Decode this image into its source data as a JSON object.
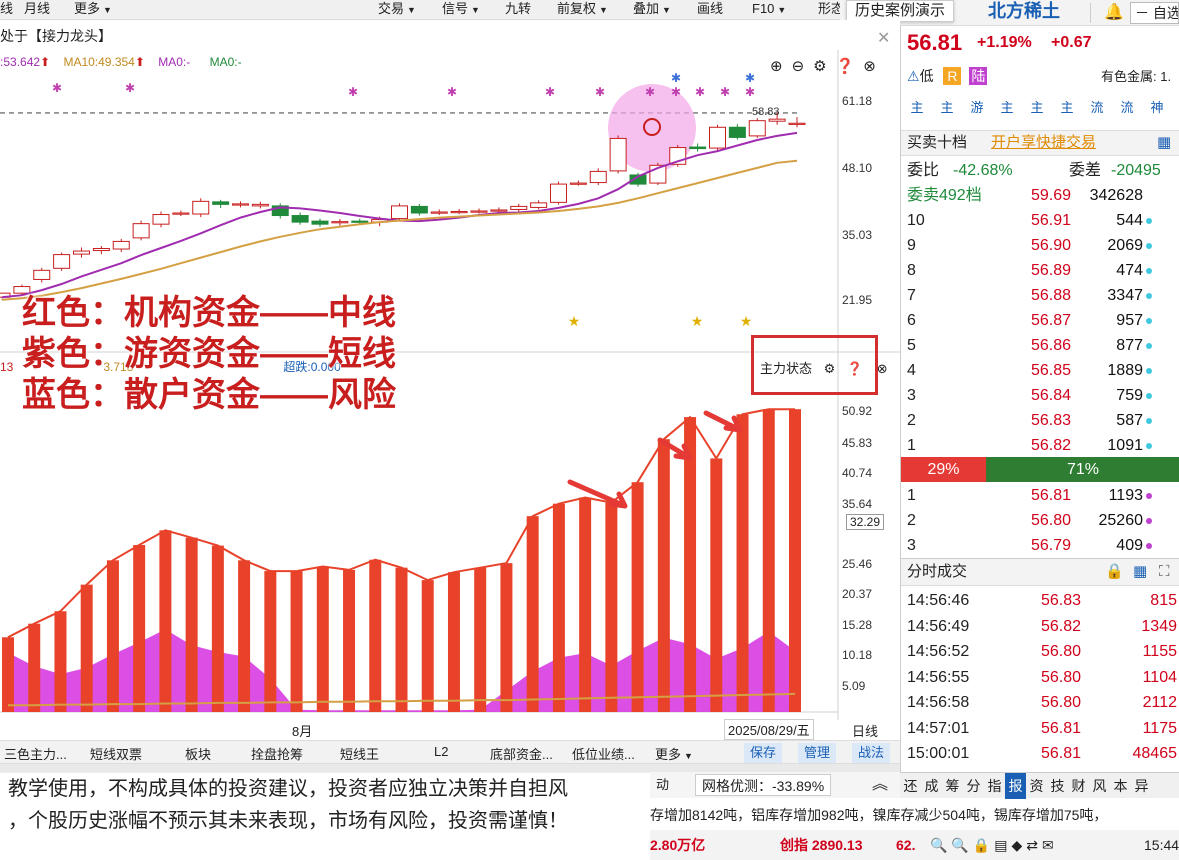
{
  "toolbar": {
    "left_items": [
      "线",
      "月线",
      "更多"
    ],
    "right_items": [
      "交易",
      "信号",
      "九转",
      "前复权",
      "叠加",
      "画线",
      "F10",
      "形态"
    ]
  },
  "history_demo": "历史案例演示",
  "stock_name": "北方稀土",
  "window_title": "处于【接力龙头】",
  "ma_legend": {
    "ma5": "53.642",
    "ma10": "MA10:49.354",
    "ma0a": "MA0:-",
    "ma0b": "MA0:-"
  },
  "upper_axis": [
    "61.18",
    "48.10",
    "35.03",
    "21.95"
  ],
  "price_marker": "58.83",
  "lower_axis": [
    "50.92",
    "45.83",
    "40.74",
    "35.64",
    "32.29",
    "25.46",
    "20.37",
    "15.28",
    "10.18",
    "5.09"
  ],
  "lower_legend": {
    "a": "13",
    "b": "3.718",
    "c": "超跌:0.000"
  },
  "lower_panel_title": "主力状态",
  "annotation": [
    "红色：机构资金——中线",
    "紫色：游资资金——短线",
    "蓝色：散户资金——风险"
  ],
  "x_axis": {
    "month": "8月",
    "date": "2025/08/29/五",
    "period": "日线"
  },
  "bottom_tabs": [
    "三色主力...",
    "短线双票",
    "板块",
    "拴盘抢筹",
    "短线王",
    "L2",
    "底部资金...",
    "低位业绩...",
    "更多"
  ],
  "bottom_buttons": [
    "保存",
    "管理",
    "战法"
  ],
  "disclaimer": [
    "教学使用，不构成具体的投资建议，投资者应独立决策并自担风",
    "，个股历史涨幅不预示其未来表现，市场有风险，投资需谨慎！"
  ],
  "grid_forecast": "网格优测：-33.89%",
  "ticker_text": "存增加8142吨，铝库存增加982吨，镍库存减少504吨，锡库存增加75吨，",
  "status_bar": {
    "a": "2.80万亿",
    "b": "创指 2890.13",
    "c": "62.",
    "time": "15:44"
  },
  "quote": {
    "price": "56.81",
    "pct": "+1.19%",
    "chg": "+0.67",
    "low_tag": "低",
    "r_tag": "R",
    "lu_tag": "陆",
    "industry": "有色金属: 1."
  },
  "flow_tags": [
    "主",
    "主",
    "游",
    "主",
    "主",
    "主",
    "流",
    "流",
    "神"
  ],
  "trade10": {
    "label": "买卖十档",
    "link": "开户享快捷交易"
  },
  "weibi": {
    "label": "委比",
    "value": "-42.68%",
    "label2": "委差",
    "value2": "-20495"
  },
  "weimai": {
    "label": "委卖492档",
    "price": "59.69",
    "vol": "342628"
  },
  "asks": [
    {
      "n": "10",
      "p": "56.91",
      "v": "544"
    },
    {
      "n": "9",
      "p": "56.90",
      "v": "2069"
    },
    {
      "n": "8",
      "p": "56.89",
      "v": "474"
    },
    {
      "n": "7",
      "p": "56.88",
      "v": "3347"
    },
    {
      "n": "6",
      "p": "56.87",
      "v": "957"
    },
    {
      "n": "5",
      "p": "56.86",
      "v": "877"
    },
    {
      "n": "4",
      "p": "56.85",
      "v": "1889"
    },
    {
      "n": "3",
      "p": "56.84",
      "v": "759"
    },
    {
      "n": "2",
      "p": "56.83",
      "v": "587"
    },
    {
      "n": "1",
      "p": "56.82",
      "v": "1091"
    }
  ],
  "ratio": {
    "sell": "29%",
    "buy": "71%"
  },
  "bids": [
    {
      "n": "1",
      "p": "56.81",
      "v": "1193"
    },
    {
      "n": "2",
      "p": "56.80",
      "v": "25260"
    },
    {
      "n": "3",
      "p": "56.79",
      "v": "409"
    }
  ],
  "ticks_title": "分时成交",
  "ticks": [
    {
      "t": "14:56:46",
      "p": "56.83",
      "v": "815"
    },
    {
      "t": "14:56:49",
      "p": "56.82",
      "v": "1349"
    },
    {
      "t": "14:56:52",
      "p": "56.80",
      "v": "1155"
    },
    {
      "t": "14:56:55",
      "p": "56.80",
      "v": "1104"
    },
    {
      "t": "14:56:58",
      "p": "56.80",
      "v": "2112"
    },
    {
      "t": "14:57:01",
      "p": "56.81",
      "v": "1175"
    },
    {
      "t": "15:00:01",
      "p": "56.81",
      "v": "48465"
    }
  ],
  "right_tabs": [
    "还",
    "成",
    "筹",
    "分",
    "指",
    "报",
    "资",
    "技",
    "财",
    "风",
    "本",
    "异"
  ],
  "colors": {
    "red": "#e8432a",
    "purple": "#d630e0",
    "ma_brown": "#d4a043",
    "ma_purple": "#a02cb0",
    "down_green": "#1f8a3a"
  },
  "chart_data": [
    {
      "type": "candlestick",
      "title": "",
      "yaxis_ticks": [
        61.18,
        48.1,
        35.03,
        21.95
      ],
      "ylim": [
        15,
        64
      ],
      "marker_price": 58.83,
      "candles": [
        [
          22.5,
          23.3,
          22.2,
          22.0
        ],
        [
          23.3,
          24.6,
          22.9,
          25.0
        ],
        [
          26.0,
          27.8,
          25.4,
          28.3
        ],
        [
          28.2,
          30.9,
          27.7,
          31.3
        ],
        [
          31.0,
          31.6,
          30.3,
          32.3
        ],
        [
          31.7,
          32.1,
          31.0,
          32.6
        ],
        [
          32.0,
          33.5,
          31.4,
          34.0
        ],
        [
          34.2,
          37.0,
          33.7,
          37.6
        ],
        [
          36.9,
          38.8,
          36.3,
          39.4
        ],
        [
          38.9,
          39.1,
          38.5,
          39.6
        ],
        [
          38.9,
          41.4,
          38.3,
          42.0
        ],
        [
          41.3,
          40.8,
          40.1,
          41.7
        ],
        [
          40.9,
          40.9,
          40.2,
          41.4
        ],
        [
          40.5,
          40.8,
          40.0,
          41.3
        ],
        [
          40.5,
          38.6,
          38.0,
          41.0
        ],
        [
          38.6,
          37.3,
          36.8,
          39.2
        ],
        [
          37.5,
          36.9,
          36.4,
          38.0
        ],
        [
          37.4,
          37.4,
          36.6,
          37.9
        ],
        [
          37.5,
          37.4,
          36.8,
          38.0
        ],
        [
          37.3,
          37.8,
          36.5,
          38.4
        ],
        [
          38.0,
          40.5,
          37.5,
          41.0
        ],
        [
          40.4,
          39.1,
          38.6,
          40.9
        ],
        [
          39.3,
          39.3,
          38.7,
          39.8
        ],
        [
          39.4,
          39.4,
          38.9,
          39.9
        ],
        [
          39.5,
          39.5,
          39.0,
          40.0
        ],
        [
          39.6,
          39.7,
          39.1,
          40.2
        ],
        [
          39.8,
          40.4,
          39.3,
          40.9
        ],
        [
          40.2,
          41.1,
          39.8,
          41.6
        ],
        [
          41.2,
          44.8,
          40.8,
          45.3
        ],
        [
          45.0,
          45.0,
          44.5,
          45.5
        ],
        [
          45.1,
          47.3,
          44.6,
          47.9
        ],
        [
          47.4,
          53.8,
          46.9,
          54.4
        ],
        [
          46.6,
          44.8,
          44.3,
          47.0
        ],
        [
          45.0,
          48.5,
          44.6,
          49.0
        ],
        [
          48.7,
          52.0,
          48.2,
          52.5
        ],
        [
          52.1,
          51.8,
          51.2,
          52.8
        ],
        [
          51.9,
          56.0,
          51.2,
          56.5
        ],
        [
          56.0,
          54.0,
          53.6,
          56.6
        ],
        [
          54.3,
          57.3,
          53.9,
          57.8
        ],
        [
          57.2,
          57.6,
          56.5,
          58.9
        ],
        [
          56.8,
          56.8,
          56.0,
          58.0
        ]
      ],
      "series": [
        {
          "name": "MA5",
          "values": [
            22.5,
            22.9,
            23.9,
            25.1,
            26.6,
            27.9,
            29.2,
            30.8,
            32.2,
            33.6,
            35.1,
            36.7,
            38.2,
            39.3,
            40.2,
            40.0,
            39.6,
            39.1,
            38.5,
            38.0,
            37.6,
            37.5,
            37.8,
            38.2,
            38.7,
            39.1,
            39.2,
            39.5,
            40.1,
            40.9,
            42.0,
            43.8,
            46.3,
            48.0,
            49.3,
            50.5,
            51.3,
            52.4,
            53.5,
            54.3,
            54.9
          ]
        },
        {
          "name": "MA10",
          "values": [
            22.0,
            22.3,
            22.8,
            23.5,
            24.3,
            25.2,
            26.1,
            27.1,
            28.1,
            29.2,
            30.3,
            31.4,
            32.5,
            33.5,
            34.4,
            35.2,
            35.9,
            36.4,
            36.9,
            37.3,
            37.6,
            37.9,
            38.2,
            38.4,
            38.6,
            38.8,
            39.0,
            39.2,
            39.5,
            39.9,
            40.4,
            41.1,
            42.0,
            43.0,
            44.0,
            45.0,
            46.0,
            47.0,
            48.0,
            49.0,
            49.4
          ]
        }
      ]
    },
    {
      "type": "bar",
      "title": "主力状态",
      "yaxis_ticks": [
        50.92,
        45.83,
        40.74,
        35.64,
        25.46,
        20.37,
        15.28,
        10.18,
        5.09
      ],
      "ylim": [
        0,
        53
      ],
      "current_value": 32.29,
      "series": [
        {
          "name": "",
          "color": "#e8432a",
          "values": [
            13.2,
            15.6,
            17.8,
            22.5,
            26.8,
            29.5,
            32.1,
            30.8,
            29.4,
            26.8,
            24.9,
            24.9,
            25.7,
            25.1,
            26.9,
            25.5,
            23.3,
            24.7,
            25.5,
            26.3,
            34.6,
            36.8,
            37.9,
            37.0,
            40.6,
            48.2,
            52.1,
            44.8,
            52.6,
            55.2,
            55.0
          ]
        },
        {
          "name": "",
          "color": "#d630e0",
          "values": [
            10.5,
            8.1,
            6.7,
            7.8,
            10.2,
            12.3,
            14.6,
            11.8,
            10.6,
            9.8,
            5.9,
            0.4,
            0.3,
            0.3,
            0.3,
            0.3,
            0.3,
            0.3,
            0.4,
            3.8,
            7.2,
            9.6,
            10.4,
            8.2,
            10.8,
            13.1,
            12.0,
            9.4,
            11.3,
            14.2,
            10.8
          ]
        },
        {
          "name": "",
          "color": "#d4a043",
          "values": [
            1.2,
            1.2,
            1.3,
            1.3,
            1.4,
            1.4,
            1.5,
            1.5,
            1.6,
            1.6,
            1.7,
            1.7,
            1.8,
            1.8,
            1.9,
            1.9,
            2.0,
            2.0,
            2.1,
            2.1,
            2.2,
            2.3,
            2.4,
            2.5,
            2.6,
            2.7,
            2.8,
            2.9,
            3.0,
            3.1,
            3.2
          ]
        }
      ]
    }
  ]
}
